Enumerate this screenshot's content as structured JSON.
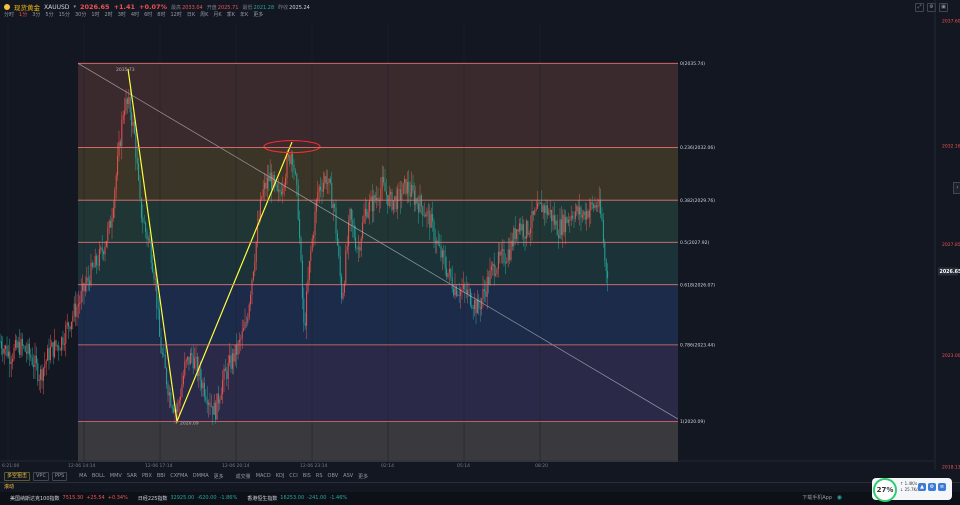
{
  "header": {
    "name": "现货黄金",
    "code": "XAUUSD",
    "price": "2026.65",
    "change": "+1.41",
    "change_pct": "+0.07%",
    "high_label": "最高",
    "high_value": "2033.04",
    "open_label": "开盘",
    "open_value": "2025.71",
    "low_label": "最低",
    "low_value": "2021.28",
    "prev_label": "昨收",
    "prev_value": "2025.24",
    "timeframes": [
      "分时",
      "1分",
      "3分",
      "5分",
      "15分",
      "30分",
      "1时",
      "2时",
      "3时",
      "4时",
      "6时",
      "8时",
      "12时",
      "日K",
      "周K",
      "月K",
      "季K",
      "年K",
      "更多"
    ],
    "active_timeframe": "1分"
  },
  "colors": {
    "up": "#ef5350",
    "down": "#26a69a",
    "fib": "#e57373",
    "trend": "#ffff3b",
    "accent": "#f0b90b"
  },
  "chart_data": {
    "type": "candlestick",
    "ylim": [
      2018.5,
      2037.5
    ],
    "price_axis_ticks": [
      "2037.60",
      "2032.16",
      "2027.85",
      "2023.00",
      "2018.13"
    ],
    "x_ticks": [
      "6:21:00",
      "12-06 14:14",
      "12-06 17:14",
      "12-06 20:14",
      "12-06 23:14",
      "02:14",
      "05:14",
      "08:20"
    ],
    "last_price_label": "2026.65",
    "fib_levels": [
      {
        "label": "0(2035.74)",
        "price": 2035.74
      },
      {
        "label": "0.236(2032.06)",
        "price": 2032.06
      },
      {
        "label": "0.382(2029.76)",
        "price": 2029.76
      },
      {
        "label": "0.5(2027.92)",
        "price": 2027.92
      },
      {
        "label": "0.618(2026.07)",
        "price": 2026.07
      },
      {
        "label": "0.786(2023.44)",
        "price": 2023.44
      },
      {
        "label": "1(2020.09)",
        "price": 2020.09
      }
    ],
    "fib_fill_colors": [
      "#3a2a2e",
      "#3a3526",
      "#1f3634",
      "#1b3338",
      "#1d2b4a",
      "#2a2a48",
      "#3a3a3e"
    ],
    "swing_high_label": "2035.73",
    "swing_low_label": "2020.09",
    "pivots": [
      {
        "t": 128,
        "price": 2035.5
      },
      {
        "t": 177,
        "price": 2020.1
      },
      {
        "t": 292,
        "price": 2032.3
      }
    ],
    "trend_line": [
      {
        "t": 78,
        "price": 2035.74
      },
      {
        "t": 678,
        "price": 2020.2
      }
    ],
    "ellipse_center": {
      "t": 292,
      "price": 2032.1
    },
    "price_path": [
      [
        0,
        2023.6
      ],
      [
        10,
        2023.0
      ],
      [
        20,
        2023.4
      ],
      [
        30,
        2023.0
      ],
      [
        40,
        2022.1
      ],
      [
        50,
        2023.2
      ],
      [
        60,
        2023.5
      ],
      [
        70,
        2024.5
      ],
      [
        80,
        2025.4
      ],
      [
        90,
        2026.5
      ],
      [
        100,
        2027.3
      ],
      [
        110,
        2028.6
      ],
      [
        118,
        2031.5
      ],
      [
        124,
        2034.0
      ],
      [
        130,
        2033.8
      ],
      [
        135,
        2032.4
      ],
      [
        140,
        2029.5
      ],
      [
        145,
        2028.5
      ],
      [
        150,
        2027.8
      ],
      [
        155,
        2026.4
      ],
      [
        160,
        2023.5
      ],
      [
        165,
        2022.3
      ],
      [
        170,
        2021.2
      ],
      [
        177,
        2020.5
      ],
      [
        185,
        2022.5
      ],
      [
        192,
        2023.0
      ],
      [
        200,
        2022.0
      ],
      [
        208,
        2021.2
      ],
      [
        215,
        2020.5
      ],
      [
        222,
        2021.8
      ],
      [
        230,
        2022.6
      ],
      [
        238,
        2023.3
      ],
      [
        246,
        2024.3
      ],
      [
        255,
        2027.5
      ],
      [
        262,
        2030.0
      ],
      [
        270,
        2030.8
      ],
      [
        278,
        2029.8
      ],
      [
        285,
        2031.0
      ],
      [
        292,
        2032.0
      ],
      [
        298,
        2029.5
      ],
      [
        304,
        2024.0
      ],
      [
        310,
        2027.2
      ],
      [
        318,
        2030.2
      ],
      [
        326,
        2030.8
      ],
      [
        334,
        2029.5
      ],
      [
        342,
        2025.5
      ],
      [
        350,
        2029.0
      ],
      [
        358,
        2027.6
      ],
      [
        366,
        2029.4
      ],
      [
        374,
        2029.7
      ],
      [
        382,
        2030.4
      ],
      [
        390,
        2029.7
      ],
      [
        398,
        2029.8
      ],
      [
        406,
        2030.4
      ],
      [
        414,
        2029.9
      ],
      [
        422,
        2029.5
      ],
      [
        430,
        2028.9
      ],
      [
        438,
        2027.7
      ],
      [
        446,
        2026.8
      ],
      [
        454,
        2026.0
      ],
      [
        462,
        2025.8
      ],
      [
        470,
        2025.6
      ],
      [
        478,
        2025.0
      ],
      [
        486,
        2026.0
      ],
      [
        494,
        2026.9
      ],
      [
        502,
        2027.2
      ],
      [
        510,
        2027.6
      ],
      [
        518,
        2028.8
      ],
      [
        526,
        2028.4
      ],
      [
        534,
        2029.0
      ],
      [
        542,
        2029.5
      ],
      [
        550,
        2029.2
      ],
      [
        558,
        2028.5
      ],
      [
        566,
        2028.9
      ],
      [
        574,
        2029.3
      ],
      [
        582,
        2029.1
      ],
      [
        590,
        2029.4
      ],
      [
        598,
        2029.6
      ],
      [
        602,
        2028.8
      ],
      [
        605,
        2027.0
      ],
      [
        608,
        2026.65
      ]
    ]
  },
  "toolbar": {
    "buttons": [
      "多空狙击",
      "VPC",
      "PPS"
    ],
    "indicators_main": [
      "MA",
      "BOLL",
      "MMV",
      "SAR",
      "PBX",
      "BBI",
      "CXFMA",
      "DMMA",
      "更多"
    ],
    "indicators_sub": [
      "成交量",
      "MACD",
      "KDJ",
      "CCI",
      "BIS",
      "RS",
      "OBV",
      "ASV",
      "更多"
    ]
  },
  "bottom_tab": "滚动",
  "ticker": [
    {
      "name": "美国纳斯达克100指数",
      "price": "7515.30",
      "chg": "+25.54",
      "pct": "+0.34%",
      "dir": "up"
    },
    {
      "name": "日经225指数",
      "price": "32925.00",
      "chg": "-620.00",
      "pct": "-1.86%",
      "dir": "down"
    },
    {
      "name": "香港恒生指数",
      "price": "16253.00",
      "chg": "-241.00",
      "pct": "-1.46%",
      "dir": "down"
    }
  ],
  "download_label": "下载手机App",
  "widget": {
    "percent": "27%",
    "rate_up": "1.4K/s",
    "rate_down": "25.7K/s"
  }
}
